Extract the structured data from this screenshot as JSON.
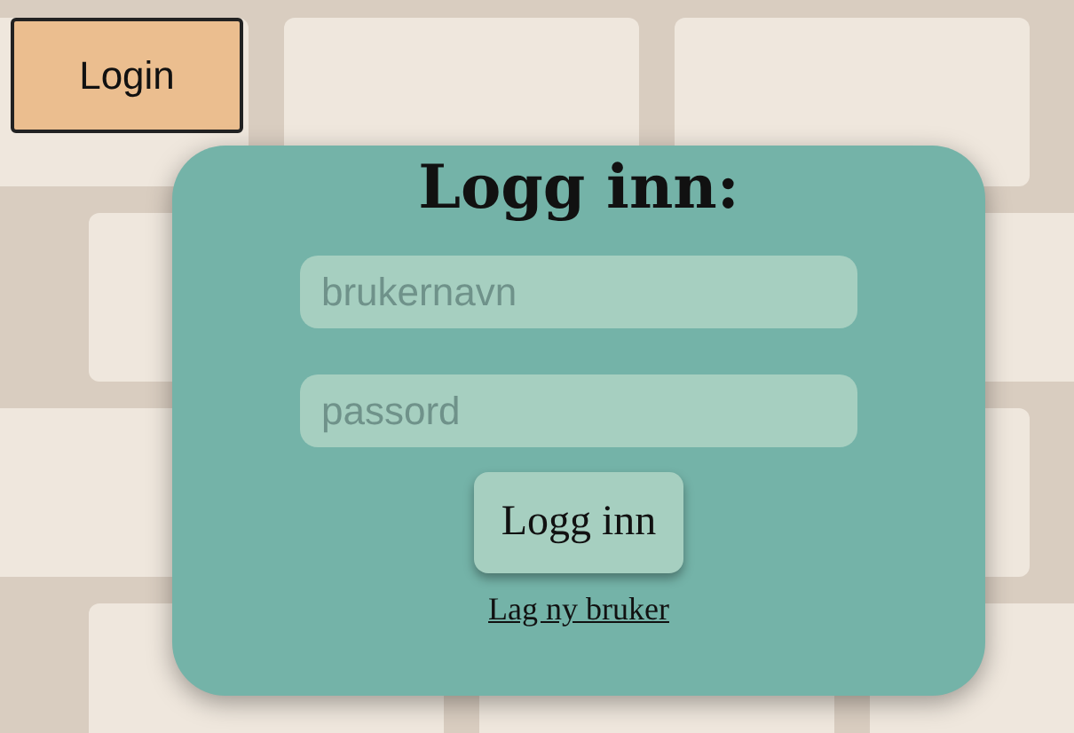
{
  "header": {
    "login_button": "Login"
  },
  "login_card": {
    "title": "Logg inn:",
    "fields": [
      {
        "placeholder": "brukernavn"
      },
      {
        "placeholder": "passord"
      }
    ],
    "submit_button": "Logg inn",
    "register_link": "Lag ny bruker"
  }
}
